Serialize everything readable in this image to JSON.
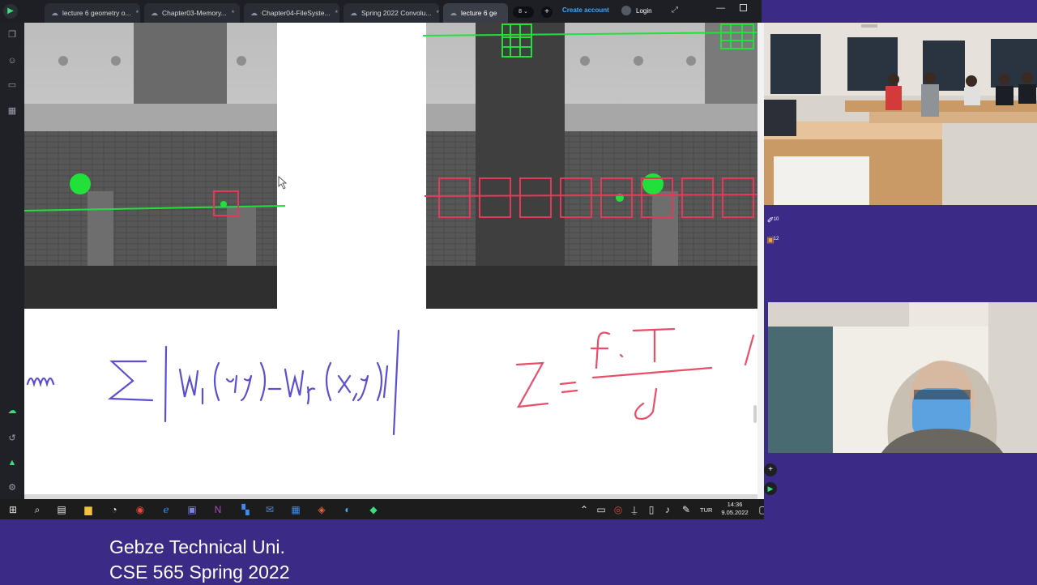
{
  "browser": {
    "tabs": [
      {
        "label": "lecture 6 geometry o...",
        "close": "*"
      },
      {
        "label": "Chapter03-Memory...",
        "close": "*"
      },
      {
        "label": "Chapter04-FileSyste...",
        "close": "*"
      },
      {
        "label": "Spring 2022 Convolu...",
        "close": "*"
      },
      {
        "label": "lecture 6 ge",
        "close": ""
      }
    ],
    "tab_count": "8",
    "create_account": "Create account",
    "login": "Login"
  },
  "whiteboard": {
    "equation_left": "m   Σ | w₁(x,y) − wᵣ(x,y) |",
    "equation_right": "Z = f·T / d",
    "colors": {
      "green": "#22e03a",
      "red": "#e23b5a",
      "blue": "#5a4fd0",
      "pink": "#e84e6a"
    }
  },
  "taskbar": {
    "lang": "TUR",
    "time": "14:36",
    "date": "9.05.2022"
  },
  "side_badges": {
    "badge1": "10",
    "badge2": "12"
  },
  "caption": {
    "line1": "Gebze Technical Uni.",
    "line2": "CSE 565 Spring 2022"
  }
}
